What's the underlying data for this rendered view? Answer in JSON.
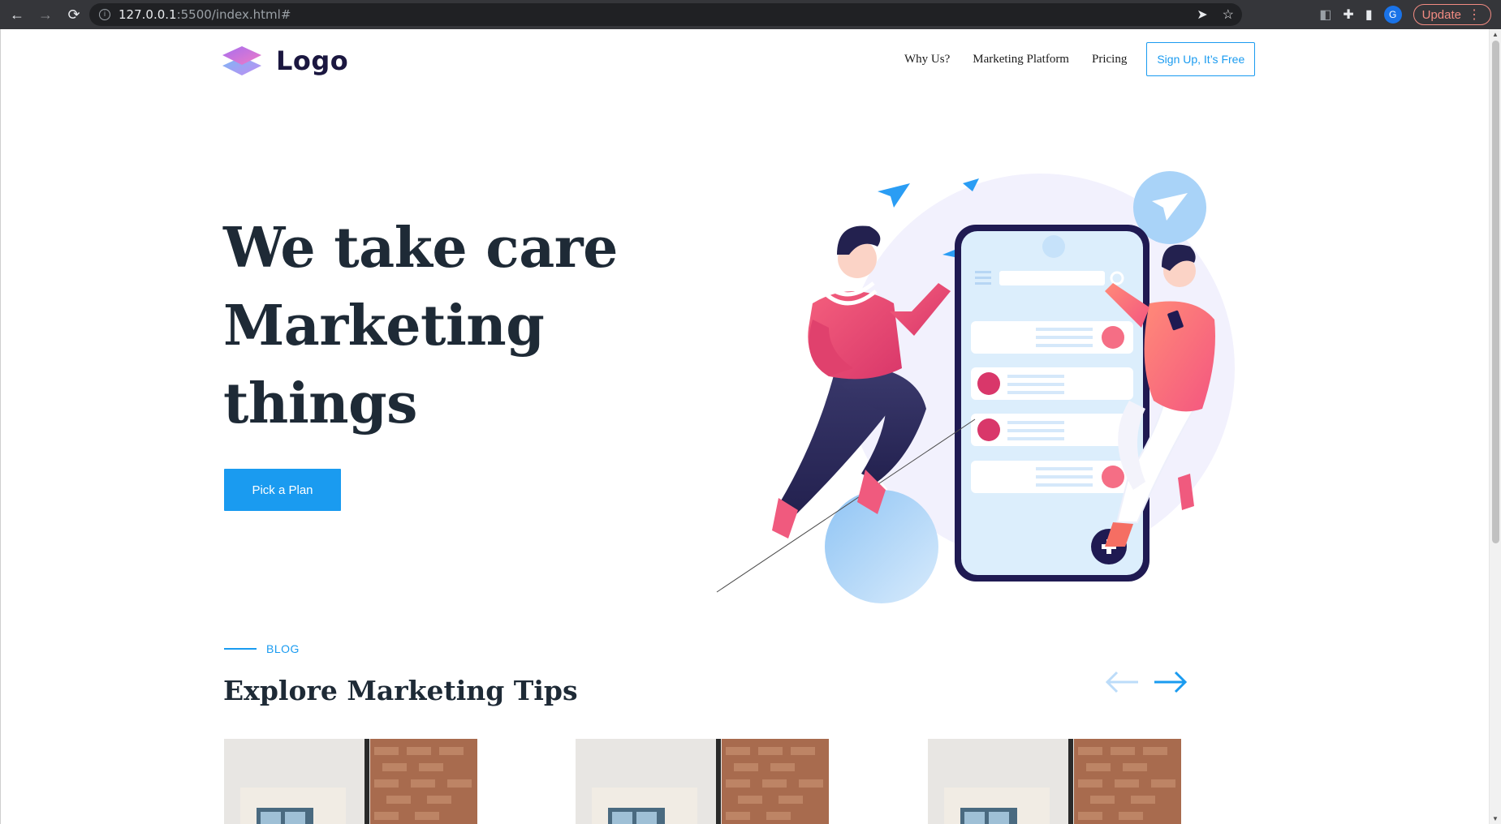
{
  "browser": {
    "url_host": "127.0.0.1",
    "url_rest": ":5500/index.html#",
    "profile_initial": "G",
    "update_label": "Update"
  },
  "header": {
    "logo_text": "Logo",
    "nav": [
      "Why Us?",
      "Marketing Platform",
      "Pricing"
    ],
    "signup_label": "Sign Up, It’s Free"
  },
  "hero": {
    "line1": "We take care",
    "line2": "Marketing",
    "line3": "things",
    "cta_label": "Pick a Plan"
  },
  "blog": {
    "tag": "BLOG",
    "title": "Explore Marketing Tips"
  },
  "colors": {
    "accent": "#1a9bf0",
    "heading": "#1e2a36",
    "highlight": "#e8e5fb"
  }
}
